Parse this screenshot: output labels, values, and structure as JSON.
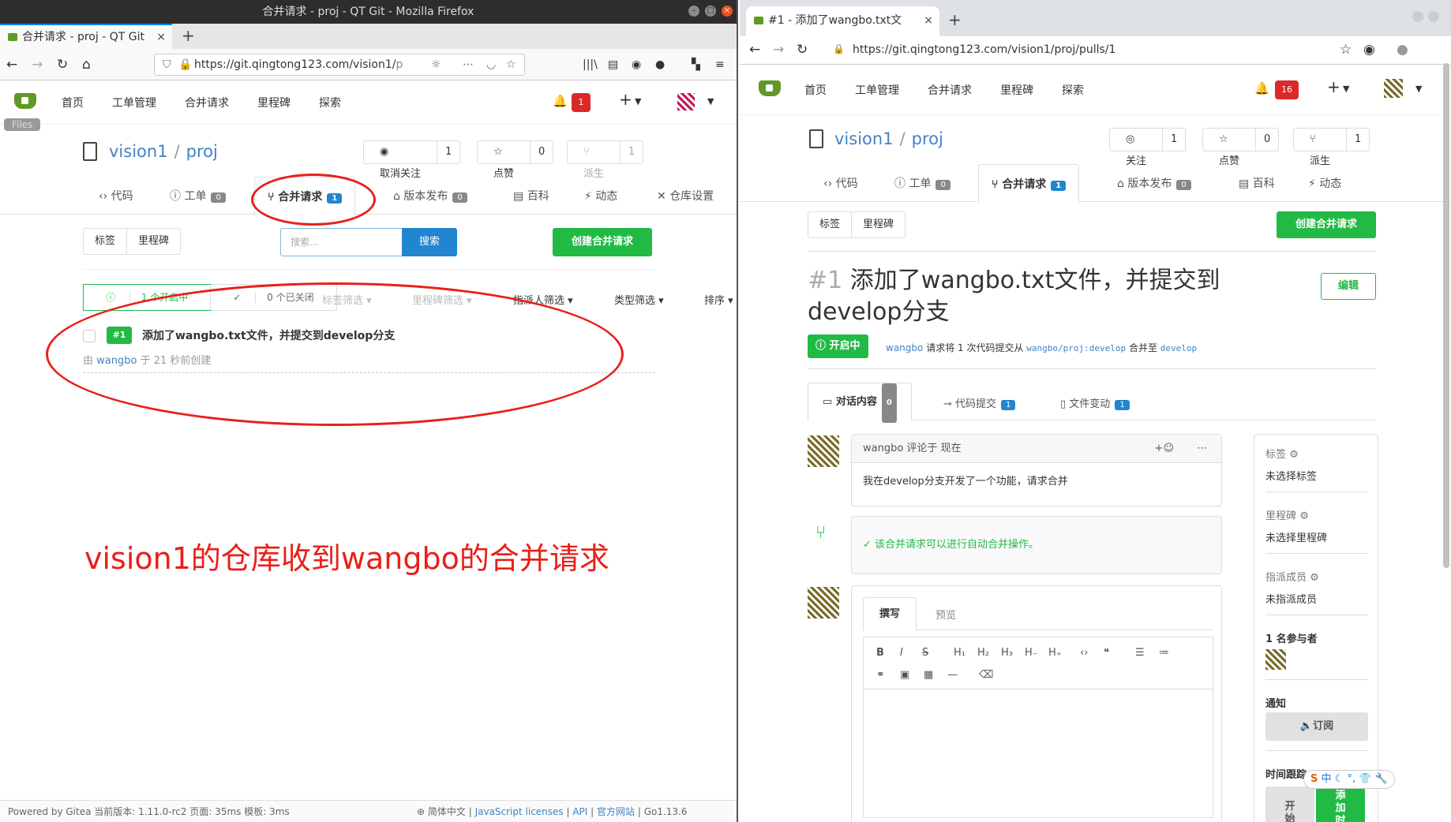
{
  "left": {
    "window_title": "合并请求 - proj - QT Git - Mozilla Firefox",
    "tab_title": "合并请求 - proj - QT Git",
    "url_main": "https://git.qingtong123.com/vision1/",
    "url_tail": "p",
    "files_tooltip": "Files",
    "nav": [
      "首页",
      "工单管理",
      "合并请求",
      "里程碑",
      "探索"
    ],
    "notif_count": "1",
    "repo_owner": "vision1",
    "repo_name": "proj",
    "watch_label": "取消关注",
    "watch_count": "1",
    "star_label": "点赞",
    "star_count": "0",
    "fork_label": "派生",
    "fork_count": "1",
    "tabs": {
      "code": "代码",
      "issues": "工单",
      "issues_count": "0",
      "pulls": "合并请求",
      "pulls_count": "1",
      "releases": "版本发布",
      "releases_count": "0",
      "wiki": "百科",
      "activity": "动态",
      "settings": "仓库设置"
    },
    "labels_btn": "标签",
    "milestones_btn": "里程碑",
    "search_placeholder": "搜索...",
    "search_btn": "搜索",
    "create_pr": "创建合并请求",
    "open_count": "1 个开启中",
    "closed_count": "0 个已关闭",
    "filters": {
      "label": "标签筛选",
      "milestone": "里程碑筛选",
      "assignee": "指派人筛选",
      "type": "类型筛选",
      "sort": "排序"
    },
    "pr": {
      "number": "#1",
      "title": "添加了wangbo.txt文件，并提交到develop分支",
      "meta_prefix": "由",
      "author": "wangbo",
      "meta_suffix": "于 21 秒前创建"
    },
    "annotation": "vision1的仓库收到wangbo的合并请求",
    "footer": {
      "powered": "Powered by Gitea 当前版本: 1.11.0-rc2 页面: 35ms 模板: 3ms",
      "lang": "简体中文",
      "js": "JavaScript licenses",
      "api": "API",
      "site": "官方网站",
      "go": "Go1.13.6"
    }
  },
  "right": {
    "tab_title": "#1 - 添加了wangbo.txt文",
    "url": "https://git.qingtong123.com/vision1/proj/pulls/1",
    "nav": [
      "首页",
      "工单管理",
      "合并请求",
      "里程碑",
      "探索"
    ],
    "notif_count": "16",
    "repo_owner": "vision1",
    "repo_name": "proj",
    "watch_label": "关注",
    "watch_count": "1",
    "star_label": "点赞",
    "star_count": "0",
    "fork_label": "派生",
    "fork_count": "1",
    "tabs": {
      "code": "代码",
      "issues": "工单",
      "issues_count": "0",
      "pulls": "合并请求",
      "pulls_count": "1",
      "releases": "版本发布",
      "releases_count": "0",
      "wiki": "百科",
      "activity": "动态"
    },
    "labels_btn": "标签",
    "milestones_btn": "里程碑",
    "create_pr": "创建合并请求",
    "pr_number": "#1",
    "pr_title_line1": "添加了wangbo.txt文件，并提交到",
    "pr_title_line2": "develop分支",
    "edit_btn": "编辑",
    "status": "开启中",
    "merge_info": {
      "author": "wangbo",
      "text1": "请求将 1 次代码提交从",
      "from": "wangbo/proj:develop",
      "text2": "合并至",
      "to": "develop"
    },
    "ptabs": {
      "conv": "对话内容",
      "conv_count": "0",
      "commits": "代码提交",
      "commits_count": "1",
      "files": "文件变动",
      "files_count": "1"
    },
    "comment": {
      "author": "wangbo",
      "action": "评论于",
      "time": "现在",
      "body": "我在develop分支开发了一个功能，请求合并"
    },
    "merge_ok": "该合并请求可以进行自动合并操作。",
    "editor": {
      "write": "撰写",
      "preview": "预览"
    },
    "sidebar": {
      "labels": "标签",
      "labels_val": "未选择标签",
      "milestone": "里程碑",
      "milestone_val": "未选择里程碑",
      "assignee": "指派成员",
      "assignee_val": "未指派成员",
      "participants": "1 名参与者",
      "notify": "通知",
      "subscribe": "订阅",
      "timetrack": "时间跟踪",
      "start": "开始",
      "add": "添加时"
    },
    "ime": "中"
  }
}
